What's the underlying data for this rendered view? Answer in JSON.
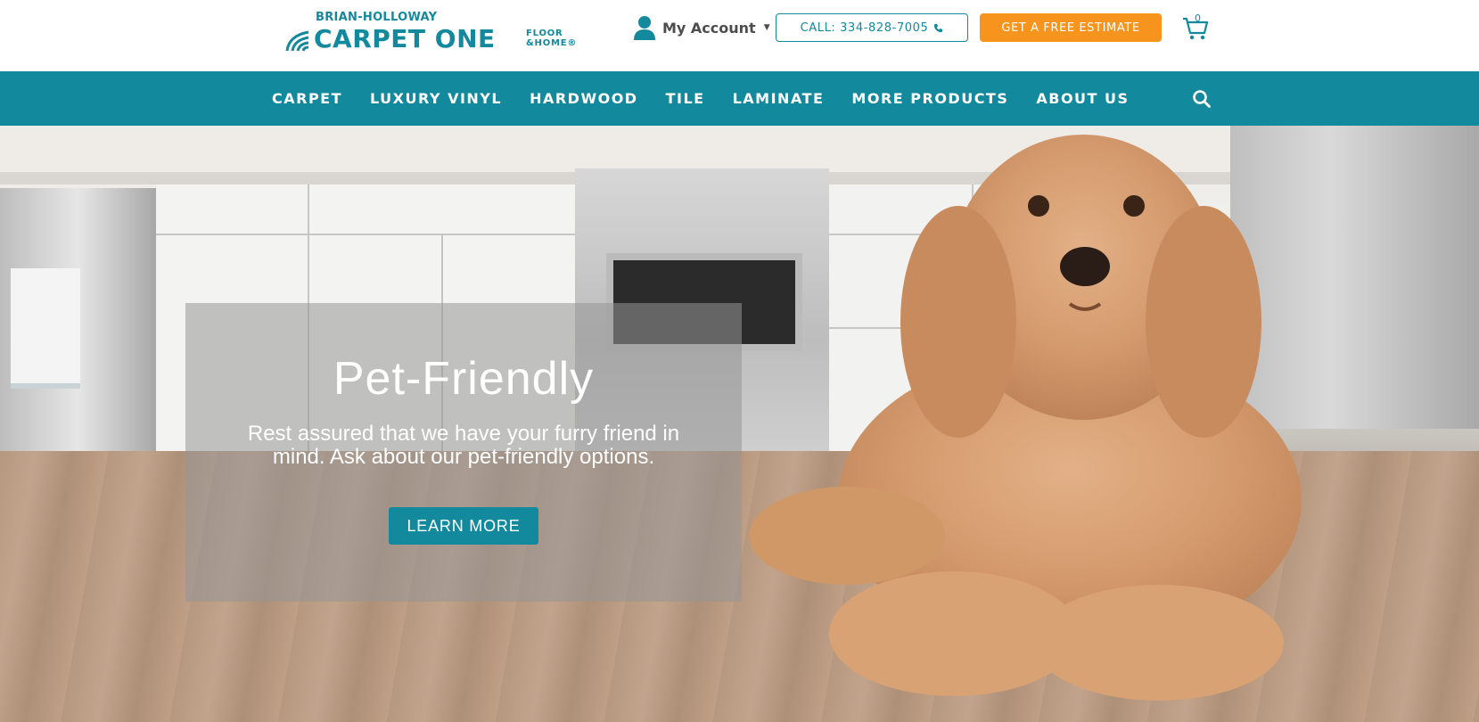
{
  "header": {
    "logo_top": "BRIAN-HOLLOWAY",
    "logo_main": "CARPET ONE",
    "logo_sub_line1": "FLOOR",
    "logo_sub_line2": "&HOME®",
    "account_label": "My Account",
    "call_label": "CALL: 334-828-7005",
    "estimate_label": "GET A FREE ESTIMATE",
    "cart_count": "0"
  },
  "nav": {
    "items": [
      "CARPET",
      "LUXURY VINYL",
      "HARDWOOD",
      "TILE",
      "LAMINATE",
      "MORE PRODUCTS",
      "ABOUT US"
    ]
  },
  "hero": {
    "title": "Pet-Friendly",
    "text": "Rest assured that we have your furry friend in mind. Ask about our pet-friendly options.",
    "button_label": "LEARN MORE"
  },
  "colors": {
    "brand_teal": "#13899d",
    "accent_orange": "#f7941d"
  },
  "icons": [
    "user-icon",
    "chevron-down-icon",
    "phone-icon",
    "cart-icon",
    "search-icon",
    "logo-arc-icon"
  ]
}
